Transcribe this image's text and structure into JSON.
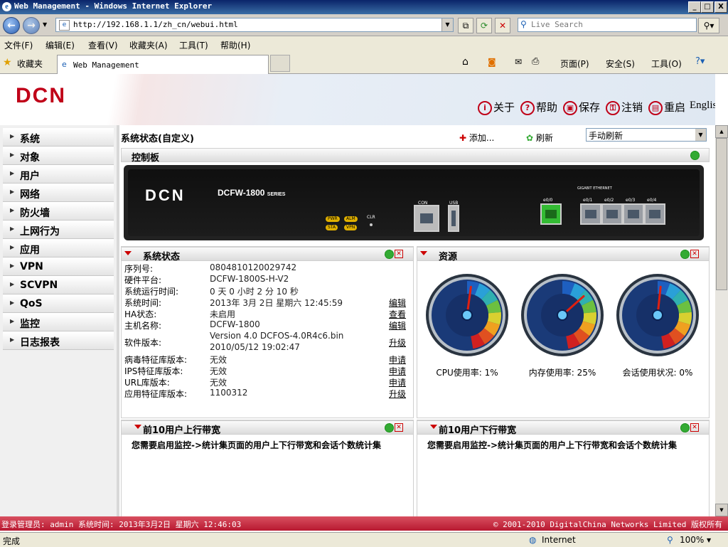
{
  "window": {
    "title": "Web Management - Windows Internet Explorer",
    "min": "_",
    "max": "□",
    "close": "X"
  },
  "address": {
    "url": "http://192.168.1.1/zh_cn/webui.html",
    "search_placeholder": "Live Search"
  },
  "menu": [
    "文件(F)",
    "编辑(E)",
    "查看(V)",
    "收藏夹(A)",
    "工具(T)",
    "帮助(H)"
  ],
  "favorites": {
    "label": "收藏夹",
    "tab_title": "Web Management",
    "commands": [
      "页面(P)",
      "安全(S)",
      "工具(O)"
    ]
  },
  "header": {
    "logo": "DCN",
    "links": [
      {
        "label": "关于",
        "icon": "i"
      },
      {
        "label": "帮助",
        "icon": "?"
      },
      {
        "label": "保存",
        "icon": "▣"
      },
      {
        "label": "注销",
        "icon": "⚿"
      },
      {
        "label": "重启",
        "icon": "▤"
      }
    ],
    "lang": "English"
  },
  "sidebar": {
    "items": [
      "系统",
      "对象",
      "用户",
      "网络",
      "防火墙",
      "上网行为",
      "应用",
      "VPN",
      "SCVPN",
      "QoS",
      "监控",
      "日志报表"
    ]
  },
  "main": {
    "title": "系统状态(自定义)",
    "add": "添加...",
    "refresh": "刷新",
    "refresh_mode": "手动刷新"
  },
  "control_panel": {
    "title": "控制板",
    "device_logo": "DCN",
    "model": "DCFW-1800",
    "model_suffix": "SERIES",
    "leds": [
      "PWR",
      "ALM",
      "STA",
      "VPN"
    ],
    "clr": "CLR",
    "con": "CON",
    "usb": "USB",
    "gigabit": "GIGABIT ETHERNET",
    "ports": [
      "e0/0",
      "e0/1",
      "e0/2",
      "e0/3",
      "e0/4"
    ]
  },
  "system_status": {
    "title": "系统状态",
    "rows": [
      {
        "key": "序列号:",
        "value": "0804810120029742",
        "action": ""
      },
      {
        "key": "硬件平台:",
        "value": "DCFW-1800S-H-V2",
        "action": ""
      },
      {
        "key": "系统运行时间:",
        "value": "0 天 0 小时 2 分 10 秒",
        "action": ""
      },
      {
        "key": "系统时间:",
        "value": "2013年  3月 2日  星期六  12:45:59",
        "action": "编辑"
      },
      {
        "key": "HA状态:",
        "value": "未启用",
        "action": "查看"
      },
      {
        "key": "主机名称:",
        "value": "DCFW-1800",
        "action": "编辑"
      },
      {
        "key": "软件版本:",
        "value": "Version 4.0 DCFOS-4.0R4c6.bin",
        "value2": "2010/05/12 19:02:47",
        "action": "升级"
      },
      {
        "key": "病毒特征库版本:",
        "value": "无效",
        "action": "申请"
      },
      {
        "key": "IPS特征库版本:",
        "value": "无效",
        "action": "申请"
      },
      {
        "key": "URL库版本:",
        "value": "无效",
        "action": "申请"
      },
      {
        "key": "应用特征库版本:",
        "value": "1100312",
        "action": "升级"
      }
    ]
  },
  "resources": {
    "title": "资源",
    "gauges": [
      {
        "label": "CPU使用率: 1%",
        "value": 1
      },
      {
        "label": "内存使用率: 25%",
        "value": 25
      },
      {
        "label": "会话使用状况: 0%",
        "value": 0
      }
    ]
  },
  "top_up": {
    "title": "前10用户上行带宽",
    "message": "您需要启用监控->统计集页面的用户上下行带宽和会话个数统计集"
  },
  "top_down": {
    "title": "前10用户下行带宽",
    "message": "您需要启用监控->统计集页面的用户上下行带宽和会话个数统计集"
  },
  "status_bar": {
    "left": "登录管理员: admin 系统时间: 2013年3月2日 星期六 12:46:03",
    "right": "© 2001-2010 DigitalChina Networks Limited 版权所有"
  },
  "ie_status": {
    "done": "完成",
    "zone": "Internet",
    "zoom": "100%"
  },
  "colors": {
    "brand_red": "#c00018",
    "status_bar": "#c8283c"
  }
}
